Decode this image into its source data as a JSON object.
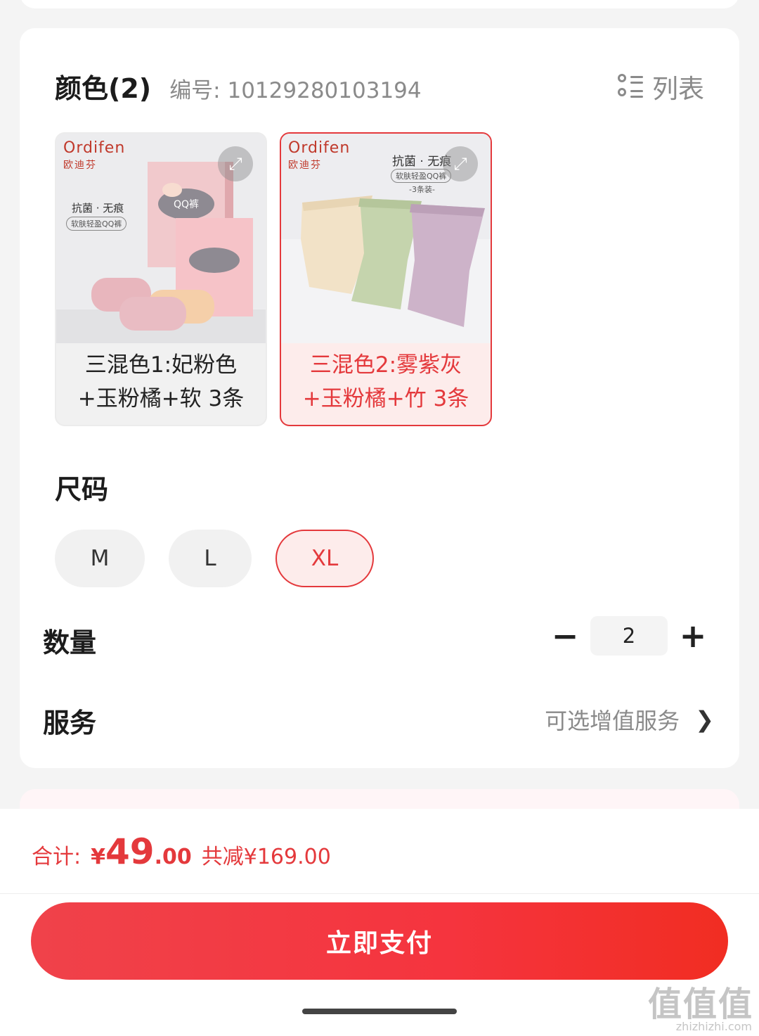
{
  "color_section": {
    "title": "颜色(2)",
    "code_label": "编号: 10129280103194",
    "list_toggle_label": "列表",
    "swatches": [
      {
        "brand_en": "Ordifen",
        "brand_cn": "欧迪芬",
        "tagline": "抗菌 · 无痕",
        "pill": "软肤轻盈QQ裤",
        "label_line1": "三混色1:妃粉色",
        "label_line2": "+玉粉橘+软 3条",
        "selected": false
      },
      {
        "brand_en": "Ordifen",
        "brand_cn": "欧迪芬",
        "tagline": "抗菌 · 无痕",
        "pill": "软肤轻盈QQ裤",
        "sub_pill": "-3条装-",
        "label_line1": "三混色2:雾紫灰",
        "label_line2": "+玉粉橘+竹 3条",
        "selected": true
      }
    ]
  },
  "size_section": {
    "title": "尺码",
    "options": [
      {
        "label": "M",
        "selected": false
      },
      {
        "label": "L",
        "selected": false
      },
      {
        "label": "XL",
        "selected": true
      }
    ]
  },
  "quantity": {
    "title": "数量",
    "minus": "−",
    "value": "2",
    "plus": "+"
  },
  "service": {
    "title": "服务",
    "link_label": "可选增值服务",
    "chevron": "❯"
  },
  "checkout": {
    "total_label": "合计:",
    "currency": "¥",
    "price_int": "49",
    "price_dec": ".00",
    "discount": "共减¥169.00",
    "pay_label": "立即支付"
  },
  "watermark": {
    "main": "值值值",
    "sub": "zhizhizhi.com"
  },
  "colors": {
    "accent": "#e4393c",
    "selected_bg": "#fdeceb",
    "pay_gradient_start": "#f0424a",
    "pay_gradient_end": "#f12d22"
  }
}
